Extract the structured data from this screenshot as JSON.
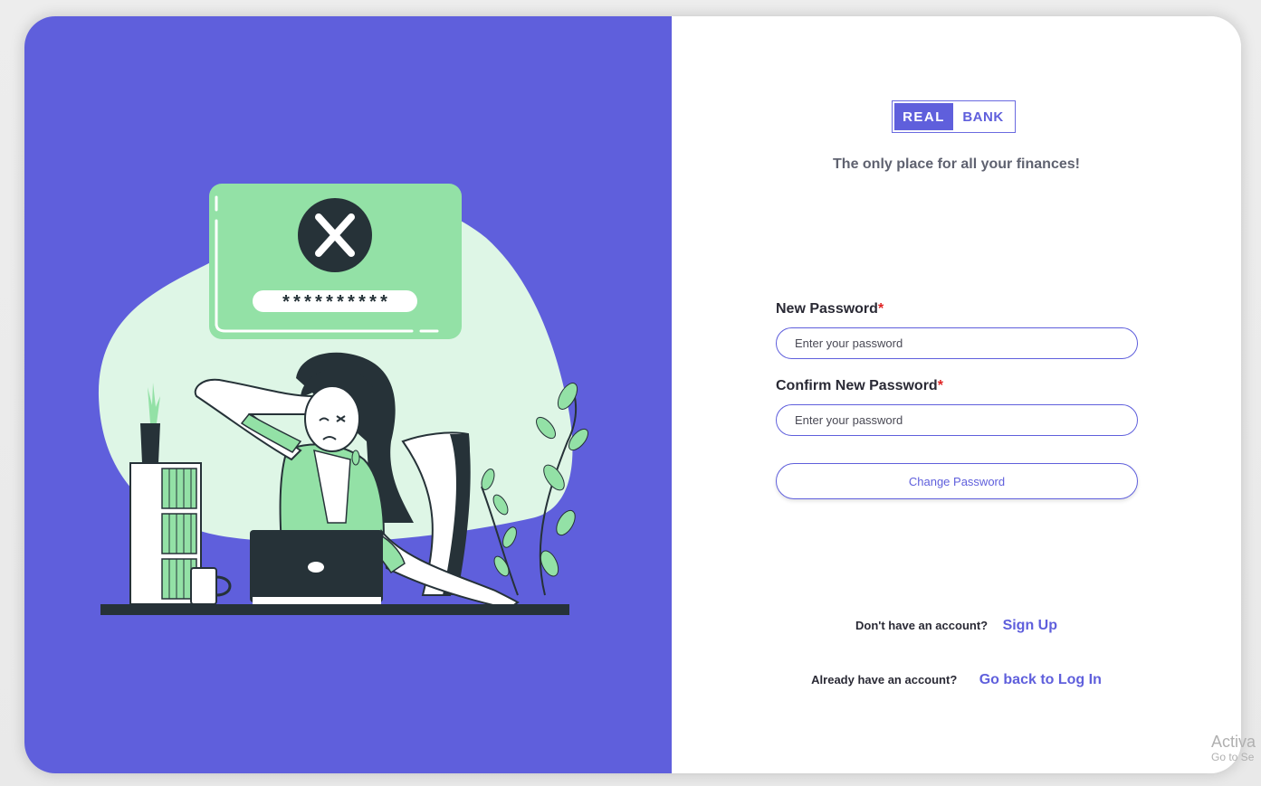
{
  "brand": {
    "logo_left": "REAL",
    "logo_right": "BANK",
    "tagline": "The only place for all your finances!"
  },
  "illustration": {
    "password_mask": "**********"
  },
  "form": {
    "new_password": {
      "label": "New Password",
      "required_mark": "*",
      "placeholder": "Enter your password"
    },
    "confirm_password": {
      "label": "Confirm New Password",
      "required_mark": "*",
      "placeholder": "Enter your password"
    },
    "submit_label": "Change Password"
  },
  "footer": {
    "signup_prompt": "Don't have an account?",
    "signup_link": "Sign Up",
    "login_prompt": "Already have an account?",
    "login_link": "Go back to Log In"
  },
  "watermark": {
    "line1": "Activa",
    "line2": "Go to Se"
  },
  "colors": {
    "primary": "#5f5fdc",
    "required": "#e02424",
    "illustration_green": "#93e1a6",
    "illustration_blob": "#def6e6"
  }
}
